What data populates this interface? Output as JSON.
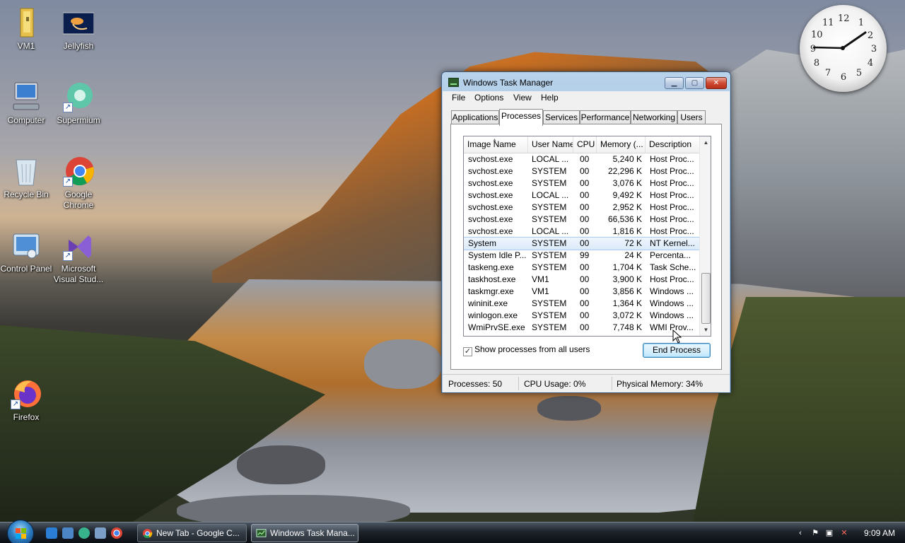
{
  "desktop": {
    "icons": [
      {
        "label": "VM1"
      },
      {
        "label": "Jellyfish"
      },
      {
        "label": "Computer"
      },
      {
        "label": "Supermium"
      },
      {
        "label": "Recycle Bin"
      },
      {
        "label": "Google Chrome"
      },
      {
        "label": "Control Panel"
      },
      {
        "label": "Microsoft Visual Stud..."
      },
      {
        "label": "Firefox"
      }
    ],
    "clock_numbers": [
      "12",
      "1",
      "2",
      "3",
      "4",
      "5",
      "6",
      "7",
      "8",
      "9",
      "10",
      "11"
    ]
  },
  "window": {
    "title": "Windows Task Manager",
    "menu": [
      "File",
      "Options",
      "View",
      "Help"
    ],
    "tabs": [
      "Applications",
      "Processes",
      "Services",
      "Performance",
      "Networking",
      "Users"
    ],
    "active_tab": "Processes",
    "columns": [
      "Image Name",
      "User Name",
      "CPU",
      "Memory (...",
      "Description"
    ],
    "processes": [
      {
        "name": "svchost.exe",
        "user": "LOCAL ...",
        "cpu": "00",
        "mem": "5,240 K",
        "desc": "Host Proc..."
      },
      {
        "name": "svchost.exe",
        "user": "SYSTEM",
        "cpu": "00",
        "mem": "22,296 K",
        "desc": "Host Proc..."
      },
      {
        "name": "svchost.exe",
        "user": "SYSTEM",
        "cpu": "00",
        "mem": "3,076 K",
        "desc": "Host Proc..."
      },
      {
        "name": "svchost.exe",
        "user": "LOCAL ...",
        "cpu": "00",
        "mem": "9,492 K",
        "desc": "Host Proc..."
      },
      {
        "name": "svchost.exe",
        "user": "SYSTEM",
        "cpu": "00",
        "mem": "2,952 K",
        "desc": "Host Proc..."
      },
      {
        "name": "svchost.exe",
        "user": "SYSTEM",
        "cpu": "00",
        "mem": "66,536 K",
        "desc": "Host Proc..."
      },
      {
        "name": "svchost.exe",
        "user": "LOCAL ...",
        "cpu": "00",
        "mem": "1,816 K",
        "desc": "Host Proc..."
      },
      {
        "name": "System",
        "user": "SYSTEM",
        "cpu": "00",
        "mem": "72 K",
        "desc": "NT Kernel..."
      },
      {
        "name": "System Idle P...",
        "user": "SYSTEM",
        "cpu": "99",
        "mem": "24 K",
        "desc": "Percenta..."
      },
      {
        "name": "taskeng.exe",
        "user": "SYSTEM",
        "cpu": "00",
        "mem": "1,704 K",
        "desc": "Task Sche..."
      },
      {
        "name": "taskhost.exe",
        "user": "VM1",
        "cpu": "00",
        "mem": "3,900 K",
        "desc": "Host Proc..."
      },
      {
        "name": "taskmgr.exe",
        "user": "VM1",
        "cpu": "00",
        "mem": "3,856 K",
        "desc": "Windows ..."
      },
      {
        "name": "wininit.exe",
        "user": "SYSTEM",
        "cpu": "00",
        "mem": "1,364 K",
        "desc": "Windows ..."
      },
      {
        "name": "winlogon.exe",
        "user": "SYSTEM",
        "cpu": "00",
        "mem": "3,072 K",
        "desc": "Windows ..."
      },
      {
        "name": "WmiPrvSE.exe",
        "user": "SYSTEM",
        "cpu": "00",
        "mem": "7,748 K",
        "desc": "WMI Prov..."
      }
    ],
    "selected_process": "System",
    "show_all_users_label": "Show processes from all users",
    "end_process_label": "End Process",
    "status": {
      "processes": "Processes: 50",
      "cpu": "CPU Usage: 0%",
      "memory": "Physical Memory: 34%"
    }
  },
  "taskbar": {
    "buttons": [
      {
        "label": "New Tab - Google C..."
      },
      {
        "label": "Windows Task Mana..."
      }
    ],
    "time": "9:09 AM"
  },
  "colors": {
    "accent": "#3c7fb1",
    "selection": "#dbeaf9",
    "close_button": "#cf4b33"
  }
}
